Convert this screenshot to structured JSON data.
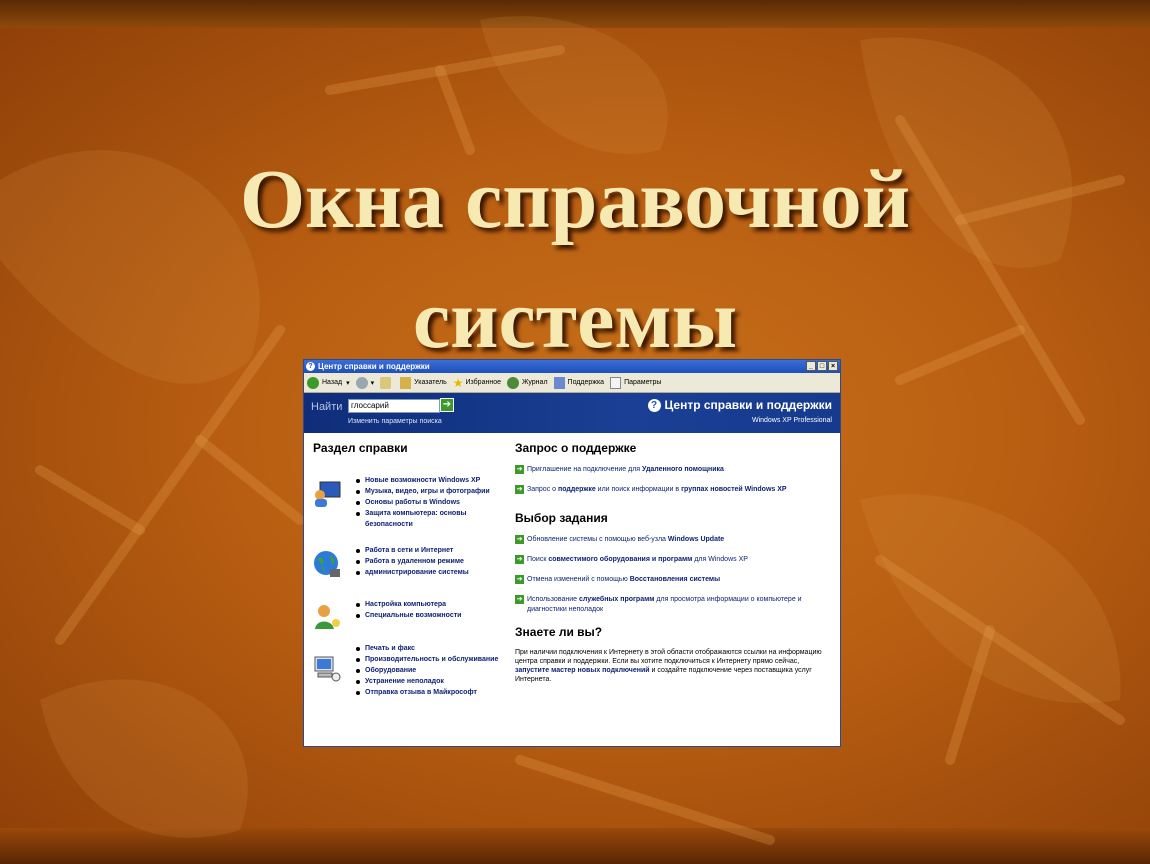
{
  "slide": {
    "title_line1": "Окна справочной",
    "title_line2": "системы"
  },
  "window": {
    "title": "Центр справки и поддержки",
    "toolbar": {
      "back": "Назад",
      "index": "Указатель",
      "favorites": "Избранное",
      "history": "Журнал",
      "support": "Поддержка",
      "options": "Параметры"
    },
    "banner": {
      "find_label": "Найти",
      "search_value": "глоссарий",
      "search_options": "Изменить параметры поиска",
      "title": "Центр справки и поддержки",
      "edition": "Windows XP Professional"
    },
    "help_topics": {
      "heading": "Раздел справки",
      "groups": [
        {
          "icon": "monitor-users-icon",
          "items": [
            "Новые возможности Windows XP",
            "Музыка, видео, игры и фотографии",
            "Основы работы в Windows",
            "Защита компьютера: основы безопасности"
          ]
        },
        {
          "icon": "globe-icon",
          "items": [
            "Работа в сети и Интернет",
            "Работа в удаленном режиме",
            "администрирование системы"
          ]
        },
        {
          "icon": "user-settings-icon",
          "items": [
            "Настройка компьютера",
            "Специальные возможности"
          ]
        },
        {
          "icon": "devices-icon",
          "items": [
            "Печать и факс",
            "Производительность и обслуживание",
            "Оборудование",
            "Устранение неполадок",
            "Отправка отзыва в Майкрософт"
          ]
        }
      ]
    },
    "support_request": {
      "heading": "Запрос о поддержке",
      "items": [
        {
          "pre": "Приглашение на подключение для ",
          "bold": "Удаленного помощника",
          "post": ""
        },
        {
          "pre": "Запрос о ",
          "bold": "поддержке",
          "post": " или поиск информации в ",
          "bold2": "группах новостей Windows XP"
        }
      ]
    },
    "pick_task": {
      "heading": "Выбор задания",
      "items": [
        {
          "pre": "Обновление системы с помощью веб-узла ",
          "bold": "Windows Update",
          "post": ""
        },
        {
          "pre": "Поиск ",
          "bold": "совместимого оборудования и программ",
          "post": " для Windows XP"
        },
        {
          "pre": "Отмена изменений с помощью ",
          "bold": "Восстановления системы",
          "post": ""
        },
        {
          "pre": "Использование ",
          "bold": "служебных программ",
          "post": " для просмотра информации о компьютере и диагностики неполадок"
        }
      ]
    },
    "did_you_know": {
      "heading": "Знаете ли вы?",
      "text1": "При наличии подключения к Интернету в этой области отображаются ссылки на информацию центра справки и поддержки. Если вы хотите подключиться к Интернету прямо сейчас,",
      "link": "запустите мастер новых подключений",
      "text2": " и создайте подключение через поставщика услуг Интернета."
    }
  },
  "colors": {
    "background": "#b85e12",
    "title": "#f6e9b2",
    "banner": "#0f2d7a",
    "link": "#0b1f73",
    "arrow": "#3d9a2a"
  }
}
